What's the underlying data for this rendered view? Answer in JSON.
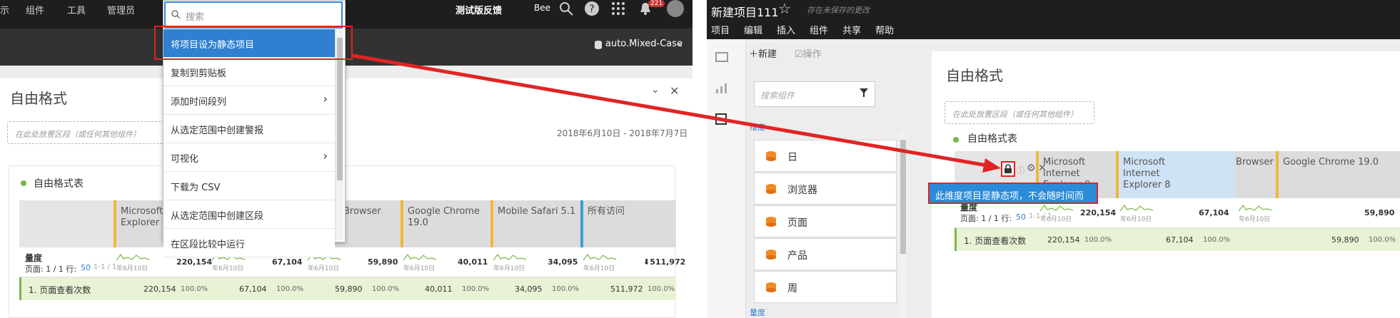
{
  "left": {
    "topnav": {
      "items": [
        "示",
        "组件",
        "工具",
        "管理员"
      ],
      "feedback": "测试版反馈",
      "user": "Bee",
      "badge": "221"
    },
    "subbar": {
      "suite": "auto.Mixed-Case"
    },
    "panel_title": "自由格式",
    "drop_hint": "在此处放置区段（或任何其他组件）",
    "date_range": "2018年6月10日 - 2018年7月7日",
    "table_title": "自由格式表",
    "columns": [
      {
        "label": "Microsoft Internet Explorer 9"
      },
      {
        "label": ""
      },
      {
        "label": "Browser"
      },
      {
        "label": "Google Chrome 19.0"
      },
      {
        "label": "Mobile Safari 5.1"
      },
      {
        "label": "所有访问"
      }
    ],
    "dimension_label": "量度",
    "paging": "页面: 1 / 1 行:",
    "rows_count": "50",
    "paging_suffix": "1-1 / 1",
    "spark_date": "年6月10日",
    "totals": [
      "220,154",
      "67,104",
      "59,890",
      "40,011",
      "34,095",
      "⬇511,972"
    ],
    "metric_row": {
      "label": "1.  页面查看次数",
      "values": [
        "220,154",
        "67,104",
        "59,890",
        "40,011",
        "34,095",
        "511,972"
      ],
      "pcts": [
        "100.0%",
        "100.0%",
        "100.0%",
        "100.0%",
        "100.0%",
        "100.0%"
      ]
    }
  },
  "menu": {
    "search_placeholder": "搜索",
    "items": [
      {
        "label": "将项目设为静态项目",
        "selected": true
      },
      {
        "label": "复制到剪贴板"
      },
      {
        "label": "添加时间段列",
        "arrow": true
      },
      {
        "label": "从选定范围中创建警报"
      },
      {
        "label": "可视化",
        "arrow": true
      },
      {
        "label": "下载为 CSV"
      },
      {
        "label": "从选定范围中创建区段"
      },
      {
        "label": "在区段比较中运行"
      }
    ]
  },
  "right": {
    "project_title": "新建项目111",
    "unsaved": "存在未保存的更改",
    "menus": [
      "项目",
      "编辑",
      "插入",
      "组件",
      "共享",
      "帮助"
    ],
    "new_label": "新建",
    "ops_label": "操作",
    "search_components": "搜索组件",
    "dim_header": "维度",
    "components": [
      "日",
      "浏览器",
      "页面",
      "产品",
      "周"
    ],
    "metrics_header": "量度",
    "panel_title": "自由格式",
    "drop_hint": "在此处放置区段（或任何其他组件）",
    "table_title": "自由格式表",
    "columns": [
      "Microsoft Internet Explorer 9",
      "Microsoft Internet Explorer 8",
      "Browser",
      "Google Chrome 19.0"
    ],
    "dimension_label": "量度",
    "paging": "页面: 1 / 1 行:",
    "rows_count": "50",
    "paging_suffix": "1-1 / 1",
    "spark_date": "年6月10日",
    "totals": [
      "220,154",
      "67,104",
      "59,890"
    ],
    "metric_row": {
      "label": "1.  页面查看次数",
      "values": [
        "220,154",
        "67,104",
        "59,890"
      ],
      "pcts": [
        "100.0%",
        "100.0%",
        "100.0%"
      ]
    },
    "tooltip": "此维度项目是静态项，不会随时间而更改。"
  },
  "colors": {
    "accent": "#2f80d1",
    "annotation": "#e02424",
    "column_marker": "#f0b83a",
    "row_bg": "#e8f2d4"
  }
}
